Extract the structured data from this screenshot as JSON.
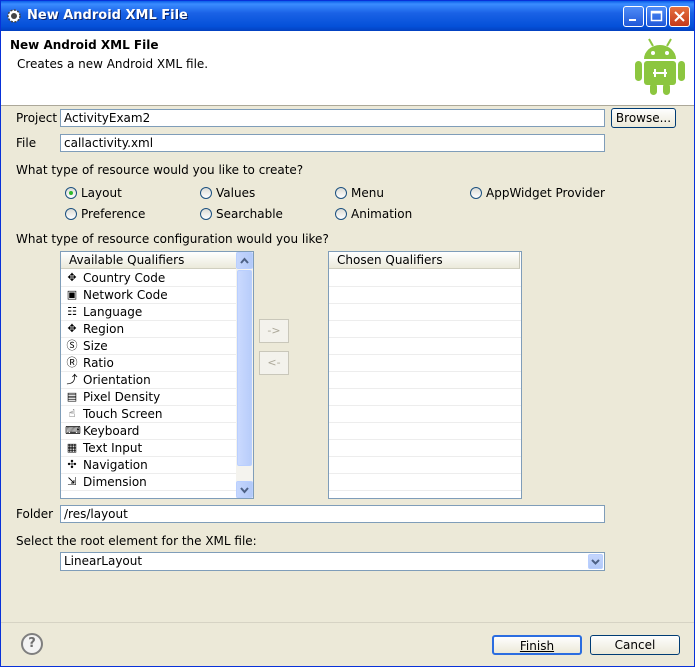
{
  "window": {
    "title": "New Android XML File"
  },
  "header": {
    "title": "New Android XML File",
    "description": "Creates a new Android XML file."
  },
  "project": {
    "label": "Project",
    "value": "ActivityExam2",
    "browse_label": "Browse..."
  },
  "file": {
    "label": "File",
    "value": "callactivity.xml"
  },
  "resource_type": {
    "question": "What type of resource would you like to create?",
    "options": [
      "Layout",
      "Values",
      "Menu",
      "AppWidget Provider",
      "Preference",
      "Searchable",
      "Animation"
    ],
    "selected": "Layout"
  },
  "configuration": {
    "question": "What type of resource configuration would you like?",
    "available_header": "Available Qualifiers",
    "chosen_header": "Chosen Qualifiers",
    "available": [
      {
        "label": "Country Code",
        "icon": "country-code-icon",
        "glyph": "✥"
      },
      {
        "label": "Network Code",
        "icon": "network-code-icon",
        "glyph": "▣"
      },
      {
        "label": "Language",
        "icon": "language-icon",
        "glyph": "☷"
      },
      {
        "label": "Region",
        "icon": "region-icon",
        "glyph": "✥"
      },
      {
        "label": "Size",
        "icon": "size-icon",
        "glyph": "Ⓢ"
      },
      {
        "label": "Ratio",
        "icon": "ratio-icon",
        "glyph": "Ⓡ"
      },
      {
        "label": "Orientation",
        "icon": "orientation-icon",
        "glyph": "⤴"
      },
      {
        "label": "Pixel Density",
        "icon": "pixel-density-icon",
        "glyph": "▤"
      },
      {
        "label": "Touch Screen",
        "icon": "touch-screen-icon",
        "glyph": "☝"
      },
      {
        "label": "Keyboard",
        "icon": "keyboard-icon",
        "glyph": "⌨"
      },
      {
        "label": "Text Input",
        "icon": "text-input-icon",
        "glyph": "▦"
      },
      {
        "label": "Navigation",
        "icon": "navigation-icon",
        "glyph": "✣"
      },
      {
        "label": "Dimension",
        "icon": "dimension-icon",
        "glyph": "⇲"
      }
    ],
    "add_label": "->",
    "remove_label": "<-"
  },
  "folder": {
    "label": "Folder",
    "value": "/res/layout"
  },
  "root_element": {
    "label": "Select the root element for the XML file:",
    "value": "LinearLayout"
  },
  "buttons": {
    "finish": "Finish",
    "cancel": "Cancel",
    "help": "?"
  }
}
